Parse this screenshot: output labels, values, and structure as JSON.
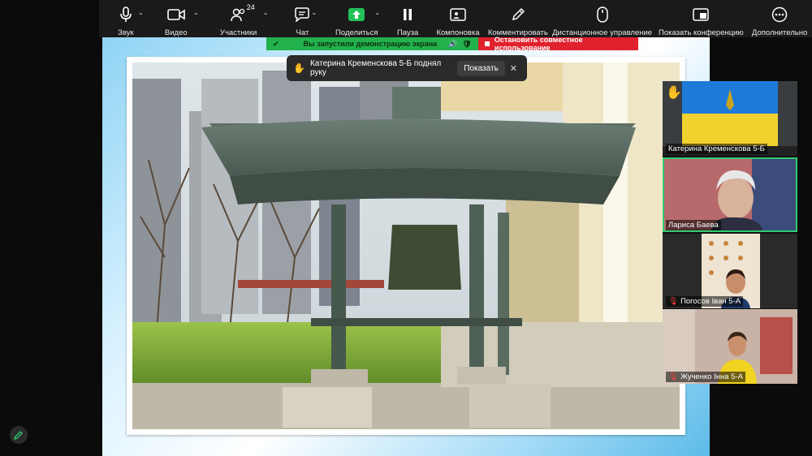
{
  "toolbar": {
    "audio": {
      "label": "Звук",
      "icon": "microphone-icon"
    },
    "video": {
      "label": "Видео",
      "icon": "video-camera-icon"
    },
    "participants": {
      "label": "Участники",
      "count": "24",
      "icon": "participants-icon"
    },
    "chat": {
      "label": "Чат",
      "icon": "chat-icon"
    },
    "share": {
      "label": "Поделиться",
      "icon": "share-screen-icon"
    },
    "pause": {
      "label": "Пауза",
      "icon": "pause-icon"
    },
    "layout": {
      "label": "Компоновка",
      "icon": "layout-icon"
    },
    "annotate": {
      "label": "Комментировать",
      "icon": "pencil-icon"
    },
    "remote": {
      "label": "Дистанционное управление",
      "icon": "mouse-icon"
    },
    "show_meeting": {
      "label": "Показать конференцию",
      "icon": "show-meeting-icon"
    },
    "more": {
      "label": "Дополнительно",
      "icon": "more-icon"
    }
  },
  "share_banner": {
    "status": "Вы запустили демонстрацию экрана",
    "stop": "Остановить совместное использование",
    "colors": {
      "green": "#22b14c",
      "red": "#e0222e"
    }
  },
  "notification": {
    "text": "Катерина Кременскова 5-Б поднял руку",
    "show_button": "Показать",
    "close": "✕"
  },
  "gallery": {
    "tiles": [
      {
        "name": "Катерина Кременскова 5-Б",
        "hand_raised": true,
        "muted": false
      },
      {
        "name": "Лариса Баева",
        "hand_raised": false,
        "muted": false,
        "active_speaker": true
      },
      {
        "name": "Погосов Іван 5-А",
        "hand_raised": false,
        "muted": true
      },
      {
        "name": "Жученко Інна 5-А",
        "hand_raised": false,
        "muted": true
      }
    ]
  },
  "colors": {
    "toolbar_bg": "#1a1a1a",
    "accent_green": "#2ecc71",
    "share_icon": "#23c15a"
  }
}
